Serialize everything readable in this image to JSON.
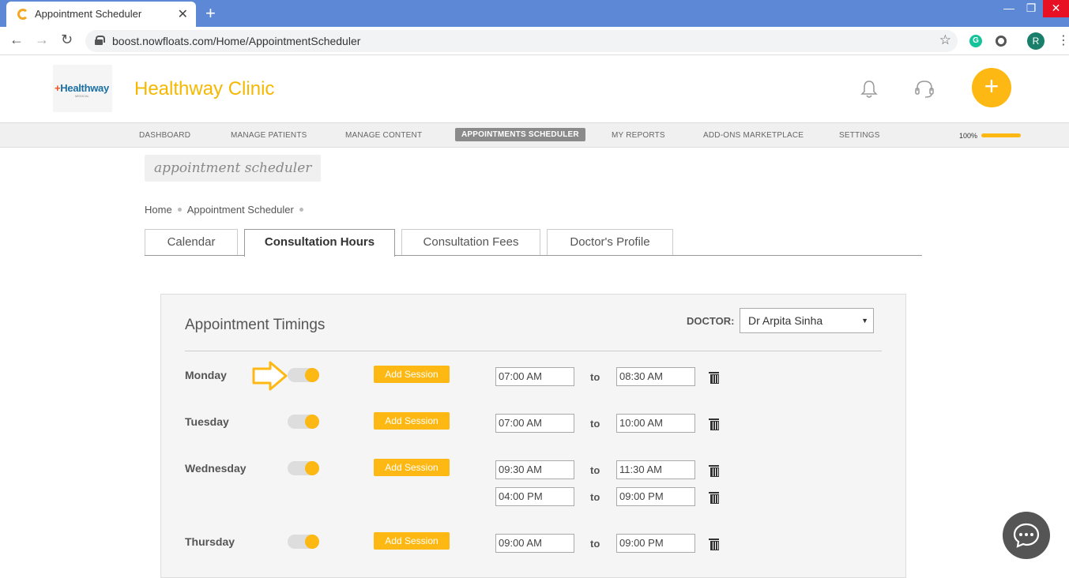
{
  "browser": {
    "tab_title": "Appointment Scheduler",
    "tab_close": "✕",
    "new_tab": "+",
    "url": "boost.nowfloats.com/Home/AppointmentScheduler",
    "profile_initial": "R",
    "ext_grammarly": "G"
  },
  "header": {
    "logo_plus": "+",
    "logo_text": "Healthway",
    "logo_sub": "MEDICAL",
    "clinic_name": "Healthway Clinic",
    "fab_label": "+"
  },
  "nav": {
    "items": [
      "DASHBOARD",
      "MANAGE PATIENTS",
      "MANAGE CONTENT",
      "APPOINTMENTS SCHEDULER",
      "MY REPORTS",
      "ADD-ONS MARKETPLACE",
      "SETTINGS"
    ],
    "active_index": 3,
    "progress_label": "100%",
    "progress_value": 1.0
  },
  "page": {
    "tag": "appointment scheduler",
    "breadcrumb": [
      "Home",
      "Appointment Scheduler"
    ]
  },
  "tabs": [
    "Calendar",
    "Consultation Hours",
    "Consultation Fees",
    "Doctor's Profile"
  ],
  "panel": {
    "title": "Appointment Timings",
    "doctor_label": "DOCTOR:",
    "doctor_selected": "Dr Arpita Sinha",
    "add_session_label": "Add Session",
    "to_label": "to",
    "days": [
      {
        "name": "Monday",
        "enabled": true,
        "sessions": [
          {
            "from": "07:00 AM",
            "to": "08:30 AM"
          }
        ]
      },
      {
        "name": "Tuesday",
        "enabled": true,
        "sessions": [
          {
            "from": "07:00 AM",
            "to": "10:00 AM"
          }
        ]
      },
      {
        "name": "Wednesday",
        "enabled": true,
        "sessions": [
          {
            "from": "09:30 AM",
            "to": "11:30 AM"
          },
          {
            "from": "04:00 PM",
            "to": "09:00 PM"
          }
        ]
      },
      {
        "name": "Thursday",
        "enabled": true,
        "sessions": [
          {
            "from": "09:00 AM",
            "to": "09:00 PM"
          }
        ]
      }
    ]
  },
  "colors": {
    "brand_yellow": "#fdb813",
    "clinic_name": "#f5b800",
    "browser_blue": "#5c88d6",
    "nav_active": "#8a8a8a"
  },
  "icons": {
    "bell": "bell-icon",
    "support": "headset-icon",
    "chat": "chat-icon",
    "delete": "trash-icon",
    "hint": "arrow-right-icon"
  }
}
